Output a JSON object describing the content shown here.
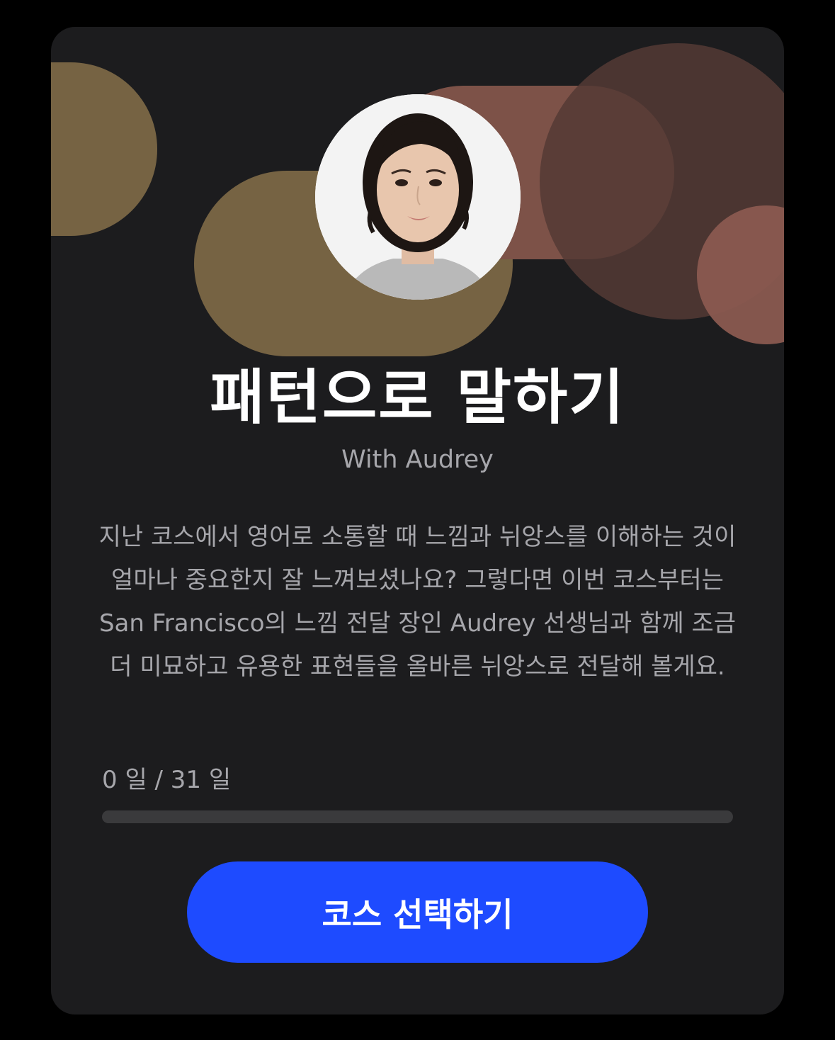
{
  "course": {
    "title": "패턴으로 말하기",
    "subtitle": "With Audrey",
    "description": "지난 코스에서 영어로 소통할 때 느낌과 뉘앙스를 이해하는 것이 얼마나 중요한지 잘 느껴보셨나요? 그렇다면 이번 코스부터는 San Francisco의 느낌 전달 장인 Audrey 선생님과 함께 조금 더 미묘하고 유용한 표현들을 올바른 뉘앙스로 전달해 볼게요.",
    "instructor_photo": "instructor-portrait"
  },
  "progress": {
    "label": "0 일 / 31 일",
    "completed_days": 0,
    "total_days": 31
  },
  "actions": {
    "select_label": "코스 선택하기"
  },
  "colors": {
    "card_background": "#1c1c1e",
    "accent_blue": "#1e4bff",
    "gold_shape": "#766343",
    "rose_shape": "#7d5248",
    "muted_text": "#a6a6ab",
    "progress_track": "#3a3a3c"
  }
}
